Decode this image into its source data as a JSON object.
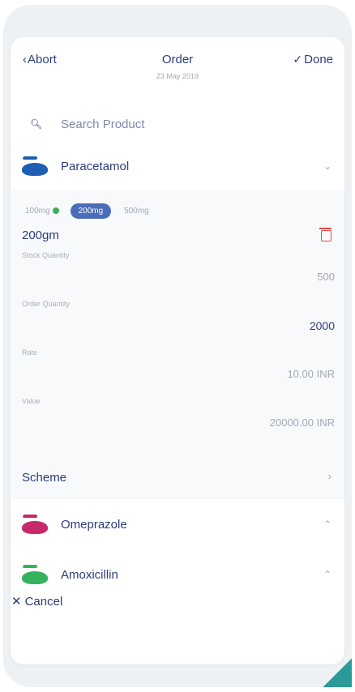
{
  "header": {
    "abort_label": "Abort",
    "title": "Order",
    "date": "23 May 2019",
    "done_label": "Done"
  },
  "search": {
    "placeholder": "Search Product"
  },
  "products": [
    {
      "name": "Paracetamol",
      "expanded": true,
      "logo_color": "#1e5fb3",
      "chevron": "down-icon"
    },
    {
      "name": "Omeprazole",
      "expanded": false,
      "logo_color": "#c42a6a",
      "chevron": "up-icon"
    },
    {
      "name": "Amoxicillin",
      "expanded": false,
      "logo_color": "#36b25d",
      "chevron": "up-icon"
    }
  ],
  "variants": [
    {
      "label": "100mg",
      "in_stock": true
    },
    {
      "label": "200mg",
      "selected": true
    },
    {
      "label": "500mg"
    }
  ],
  "selected_item": {
    "size": "200gm",
    "stock_quantity_label": "Stock Quantity",
    "stock_quantity": "500",
    "order_quantity_label": "Order Quantity",
    "order_quantity": "2000",
    "rate_label": "Rate",
    "rate": "10.00 INR",
    "value_label": "Value",
    "value": "20000.00 INR"
  },
  "scheme_label": "Scheme",
  "cancel_label": "Cancel",
  "colors": {
    "primary": "#2c3d7a",
    "accent": "#4b6cb8",
    "danger": "#e24848",
    "success": "#36b25d"
  }
}
